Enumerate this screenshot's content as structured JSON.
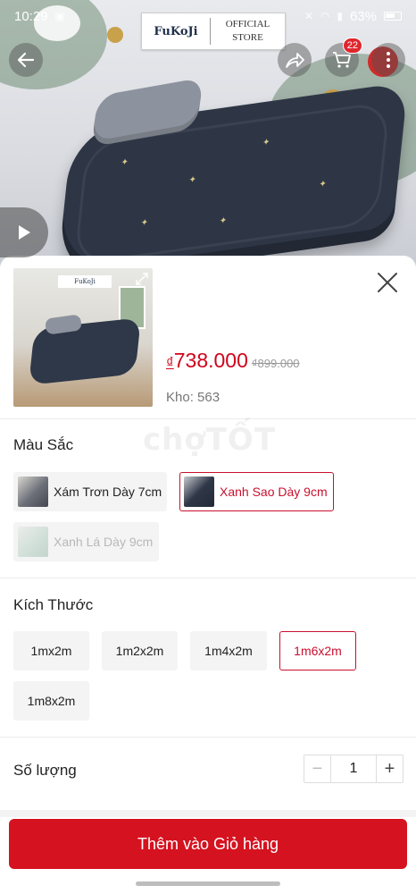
{
  "status_bar": {
    "time": "10:29",
    "battery": "63%"
  },
  "brand": {
    "name": "FuKoJi",
    "sub": "OFFICIAL STORE"
  },
  "header": {
    "cart_count": "22"
  },
  "product": {
    "currency": "₫",
    "price": "738.000",
    "old_price": "₫899.000",
    "stock": "Kho: 563"
  },
  "colors": {
    "title": "Màu Sắc",
    "options": [
      {
        "label": "Xám Trơn Dày 7cm",
        "state": "normal"
      },
      {
        "label": "Xanh Sao Dày 9cm",
        "state": "selected"
      },
      {
        "label": "Xanh Lá Dày 9cm",
        "state": "disabled"
      }
    ]
  },
  "sizes": {
    "title": "Kích Thước",
    "options": [
      {
        "label": "1mx2m",
        "state": "normal"
      },
      {
        "label": "1m2x2m",
        "state": "normal"
      },
      {
        "label": "1m4x2m",
        "state": "normal"
      },
      {
        "label": "1m6x2m",
        "state": "selected"
      },
      {
        "label": "1m8x2m",
        "state": "normal"
      }
    ]
  },
  "quantity": {
    "label": "Số lượng",
    "value": "1",
    "minus": "−",
    "plus": "+"
  },
  "cta": {
    "add_to_cart": "Thêm vào Giỏ hàng"
  },
  "watermark": "chợTỐT",
  "theme": {
    "accent": "#d5121f",
    "selected_border": "#c8102e"
  }
}
